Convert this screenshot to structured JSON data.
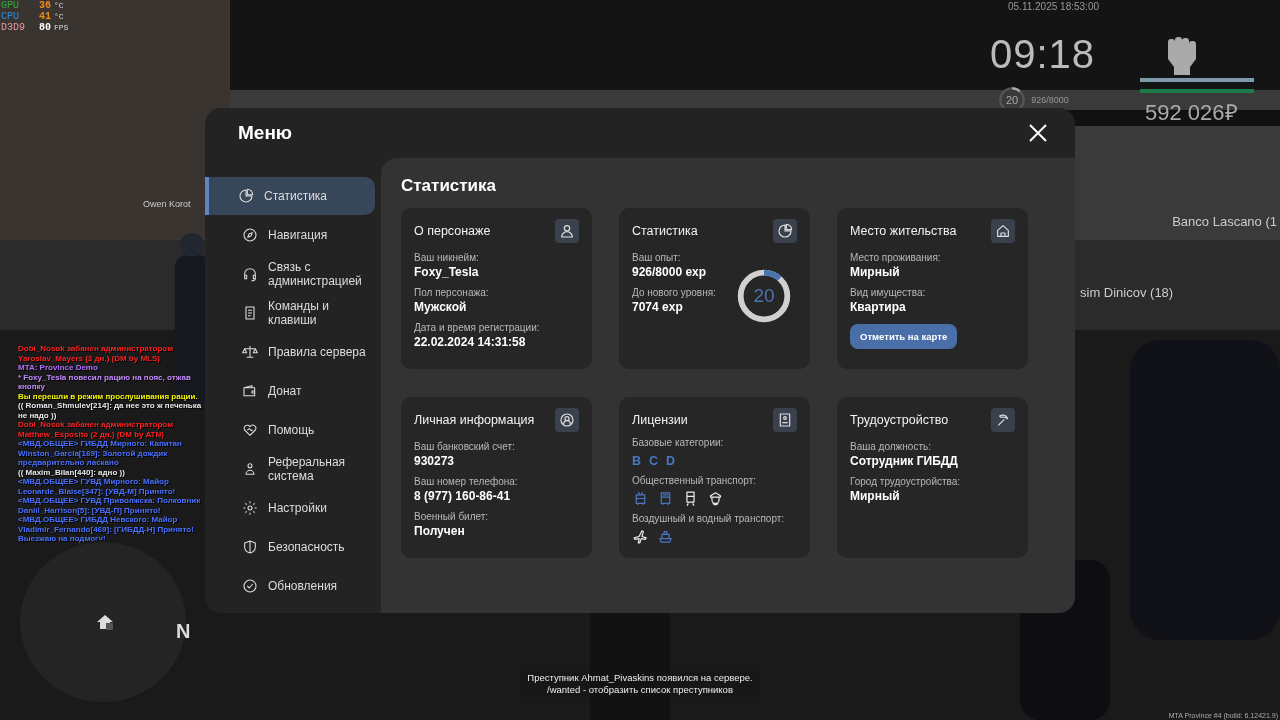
{
  "perf_overlay": [
    {
      "label": "GPU",
      "value": "36",
      "unit": "°C",
      "kind": "temperature",
      "color": "#2fae3a"
    },
    {
      "label": "CPU",
      "value": "41",
      "unit": "°C",
      "kind": "temperature",
      "color": "#2a8fe0"
    },
    {
      "label": "D3D9",
      "value": "80",
      "unit": "FPS",
      "kind": "fps",
      "color": "#e89aa0"
    }
  ],
  "hud": {
    "datetime": "05.11.2025 18:53:00",
    "clock": "09:18",
    "level_ring": {
      "value": "20",
      "level": 0.116
    },
    "experience": "926/8000",
    "bars": [
      {
        "level": 1,
        "color": "#7d9aa8"
      },
      {
        "level": 1,
        "color": "#1f7a4a"
      }
    ],
    "money": "592 026₽"
  },
  "nametags": [
    "Owen Korot",
    "Banco Lascano (1",
    "sim Dinicov (18)"
  ],
  "chat": [
    {
      "text": "Dobi_Nosok забанен администратором Yaroslav_Mayers (3 дн.) (DM by MLS)",
      "color": "#ff2020"
    },
    {
      "text": "MTA: Province Demo",
      "color": "#b070ff"
    },
    {
      "text": "* Foxy_Tesla повесил рацию на пояс, отжав кнопку",
      "color": "#c48cff"
    },
    {
      "text": "Вы перешли в режим прослушивания рации.",
      "color": "#f5f500"
    },
    {
      "text": "(( Roman_Shmulev[214]: да нее это ж печенька не надо ))",
      "color": "#e8e8e8"
    },
    {
      "text": "Dobi_Nosok забанен администратором Matthew_Esposito (2 дн.) (DM by ATN)",
      "color": "#ff2020"
    },
    {
      "text": "<МВД.ОБЩЕЕ> ГИБДД Мирного: Капитан Winston_Garcia[169]: Золотой дождик предварительно ласкано",
      "color": "#4a70ff"
    },
    {
      "text": "(( Maxim_Bilan[440]: адно ))",
      "color": "#e8e8e8"
    },
    {
      "text": "<МВД.ОБЩЕЕ> ГУВД Мирного: Майор Leonarde_Blaise[347]: [УВД-М] Принято!",
      "color": "#4a70ff"
    },
    {
      "text": "<МВД.ОБЩЕЕ> ГУВД Приволжска: Полковник Daniil_Harrison[5]: [УВД-П] Принято!",
      "color": "#4a70ff"
    },
    {
      "text": "<МВД.ОБЩЕЕ> ГИБДД Невского: Майор Vladimir_Fernando[469]: [ГИБДД-Н] Принято! Выезжаю на подмогу!",
      "color": "#4a70ff"
    }
  ],
  "minimap": {
    "compass": "N"
  },
  "menu": {
    "title": "Меню",
    "sidebar": [
      {
        "label": "Статистика",
        "selected": true
      },
      {
        "label": "Навигация",
        "selected": false
      },
      {
        "label": "Связь с администрацией",
        "selected": false
      },
      {
        "label": "Команды и клавиши",
        "selected": false
      },
      {
        "label": "Правила сервера",
        "selected": false
      },
      {
        "label": "Донат",
        "selected": false
      },
      {
        "label": "Помощь",
        "selected": false
      },
      {
        "label": "Реферальная система",
        "selected": false
      },
      {
        "label": "Настройки",
        "selected": false
      },
      {
        "label": "Безопасность",
        "selected": false
      },
      {
        "label": "Обновления",
        "selected": false
      }
    ],
    "content": {
      "title": "Статистика",
      "cards": [
        {
          "kind": "info",
          "title": "О персонаже",
          "fields": [
            {
              "label": "Ваш никнейм:",
              "value": "Foxy_Tesla"
            },
            {
              "label": "Пол персонажа:",
              "value": "Мужской"
            },
            {
              "label": "Дата и время регистрации:",
              "value": "22.02.2024 14:31:58"
            }
          ]
        },
        {
          "kind": "experience",
          "title": "Статистика",
          "fields": [
            {
              "label": "Ваш опыт:",
              "value": "926/8000 exp"
            },
            {
              "label": "До нового уровня:",
              "value": "7074 exp"
            }
          ],
          "ring": {
            "value": "20",
            "level": 0.116
          }
        },
        {
          "kind": "info",
          "title": "Место жительства",
          "fields": [
            {
              "label": "Место проживания:",
              "value": "Мирный"
            },
            {
              "label": "Вид имущества:",
              "value": "Квартира"
            }
          ],
          "button": "Отметить на карте"
        },
        {
          "kind": "info",
          "title": "Личная информация",
          "fields": [
            {
              "label": "Ваш банковский счет:",
              "value": "930273"
            },
            {
              "label": "Ваш номер телефона:",
              "value": "8 (977) 160-86-41"
            },
            {
              "label": "Военный билет:",
              "value": "Получен"
            }
          ]
        },
        {
          "kind": "license",
          "title": "Лицензии",
          "sections": [
            {
              "label": "Базовые категории:",
              "kind": "letters",
              "items": [
                {
                  "text": "B",
                  "obtained": true
                },
                {
                  "text": "C",
                  "obtained": true
                },
                {
                  "text": "D",
                  "obtained": true
                }
              ]
            },
            {
              "label": "Общественный транспорт:",
              "kind": "icons",
              "items": [
                {
                  "kind": "trolleybus",
                  "obtained": true
                },
                {
                  "kind": "bus",
                  "obtained": true
                },
                {
                  "kind": "train",
                  "obtained": false
                },
                {
                  "kind": "captain",
                  "obtained": false
                }
              ]
            },
            {
              "label": "Воздушный и водный транспорт:",
              "kind": "icons",
              "items": [
                {
                  "kind": "plane",
                  "obtained": false
                },
                {
                  "kind": "ship",
                  "obtained": true
                }
              ]
            }
          ]
        },
        {
          "kind": "info",
          "title": "Трудоустройство",
          "fields": [
            {
              "label": "Ваша должность:",
              "value": "Сотрудник ГИБДД"
            },
            {
              "label": "Город трудоустройства:",
              "value": "Мирный"
            }
          ]
        }
      ]
    }
  },
  "notification": [
    "Преступник Ahmat_Pivaskins появился на сервере.",
    "/wanted - отобразить список преступников"
  ],
  "build_info": "MTA Province #4 (build: 6.12421.9)"
}
